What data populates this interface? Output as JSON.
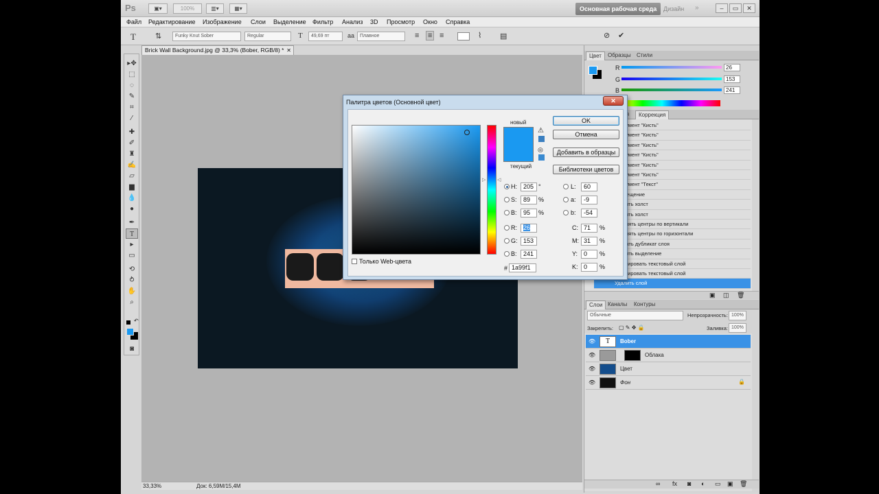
{
  "appbar": {
    "logo": "Ps",
    "zoom": "100%",
    "workspace": "Основная рабочая среда",
    "workspace2": "Дизайн"
  },
  "menu": [
    "Файл",
    "Редактирование",
    "Изображение",
    "Слои",
    "Выделение",
    "Фильтр",
    "Анализ",
    "3D",
    "Просмотр",
    "Окно",
    "Справка"
  ],
  "options": {
    "font_family": "Funky Knut Sober",
    "font_style": "Regular",
    "font_size": "49,69 пт",
    "aa_label": "аа",
    "aa_mode": "Плавное"
  },
  "document": {
    "tab_title": "Brick Wall Background.jpg @ 33,3% (Bober, RGB/8) *",
    "zoom": "33,33%",
    "doc_size": "Док: 6,59M/15,4M"
  },
  "color_panel": {
    "tabs": [
      "Цвет",
      "Образцы",
      "Стили"
    ],
    "r_label": "R",
    "g_label": "G",
    "b_label": "B",
    "r": "26",
    "g": "153",
    "b": "241"
  },
  "history_panel": {
    "tabs": [
      "История",
      "Коррекция"
    ],
    "items": [
      "румент \"Кисть\"",
      "румент \"Кисть\"",
      "румент \"Кисть\"",
      "румент \"Кисть\"",
      "румент \"Кисть\"",
      "румент \"Кисть\"",
      "румент \"Текст\"",
      "мещение",
      "вить холст",
      "вить холст",
      "внять центры по вертикали",
      "внять центры по горизонтали",
      "дать дубликат слоя",
      "нить выделение",
      "стировать текстовый слой",
      "стировать текстовый слой",
      "Удалить слой"
    ]
  },
  "layers_panel": {
    "tabs": [
      "Слои",
      "Каналы",
      "Контуры"
    ],
    "blend_mode": "Обычные",
    "opacity_label": "Непрозрачность:",
    "opacity": "100%",
    "lock_label": "Закрепить:",
    "fill_label": "Заливка:",
    "fill": "100%",
    "layers": [
      "Bober",
      "Облака",
      "Цвет",
      "Фон"
    ]
  },
  "dialog": {
    "title": "Палитра цветов (Основной цвет)",
    "new_label": "новый",
    "current_label": "текущий",
    "ok": "OK",
    "cancel": "Отмена",
    "add_swatch": "Добавить в образцы",
    "libraries": "Библиотеки цветов",
    "h": "205",
    "h_unit": "°",
    "s": "89",
    "s_unit": "%",
    "bb": "95",
    "bb_unit": "%",
    "r": "26",
    "g": "153",
    "b": "241",
    "l": "60",
    "a": "-9",
    "lab_b": "-54",
    "c": "71",
    "m": "31",
    "y": "0",
    "k": "0",
    "pct": "%",
    "hex": "1a99f1",
    "web_only": "Только Web-цвета",
    "lbl": {
      "h": "H:",
      "s": "S:",
      "bb": "B:",
      "r": "R:",
      "g": "G:",
      "b": "B:",
      "l": "L:",
      "a": "a:",
      "labb": "b:",
      "c": "C:",
      "m": "M:",
      "y": "Y:",
      "k": "K:",
      "hash": "#"
    }
  },
  "colors": {
    "fg": "#1a99f1",
    "accent": "#3a92e6"
  }
}
